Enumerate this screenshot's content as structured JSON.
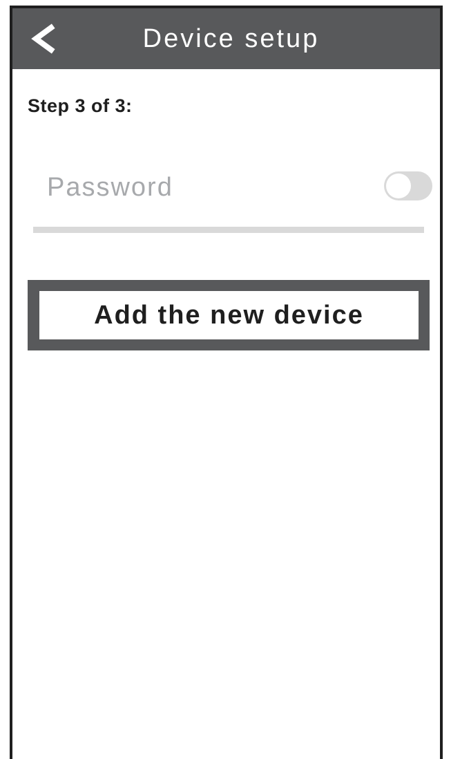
{
  "header": {
    "title": "Device setup",
    "back_icon": "chevron-left-icon"
  },
  "step": {
    "label": "Step 3 of 3:"
  },
  "password": {
    "placeholder": "Password",
    "value": "",
    "visibility_toggle": {
      "state": "off"
    }
  },
  "actions": {
    "add_label": "Add the new device"
  },
  "colors": {
    "header_bg": "#58595b",
    "header_text": "#ffffff",
    "placeholder": "#a7a9ac",
    "toggle_track": "#d9d9d9",
    "divider": "#d9d9d9",
    "button_border": "#58595b",
    "text_dark": "#1f1f1f"
  }
}
